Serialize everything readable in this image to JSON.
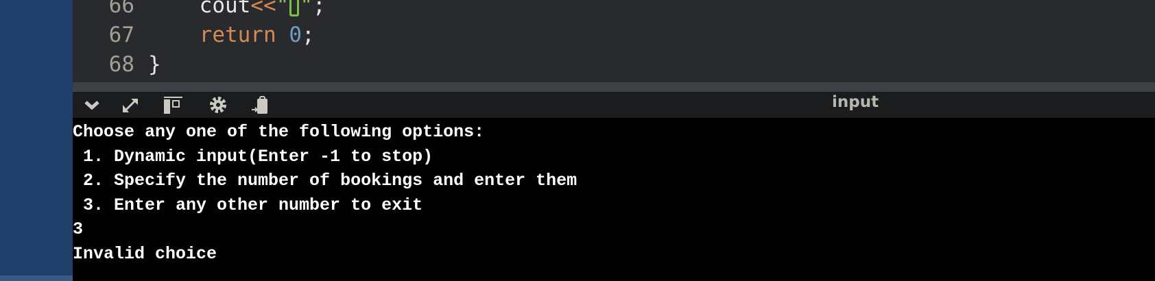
{
  "editor": {
    "lines": [
      {
        "number": "66",
        "indent": "    ",
        "parts": [
          "cout",
          "<<",
          "\"",
          "\"",
          ";"
        ]
      },
      {
        "number": "67",
        "indent": "    ",
        "parts": [
          "return",
          " ",
          "0",
          ";"
        ]
      },
      {
        "number": "68",
        "indent": "",
        "parts": [
          "}"
        ]
      }
    ]
  },
  "toolbar": {
    "title": "input",
    "icons": [
      "chevron-down-icon",
      "expand-icon",
      "layout-icon",
      "gear-icon",
      "clipboard-paste-icon"
    ]
  },
  "terminal": {
    "lines": [
      "Choose any one of the following options:",
      " 1. Dynamic input(Enter -1 to stop)",
      " 2. Specify the number of bookings and enter them",
      " 3. Enter any other number to exit",
      "3",
      "Invalid choice"
    ]
  }
}
